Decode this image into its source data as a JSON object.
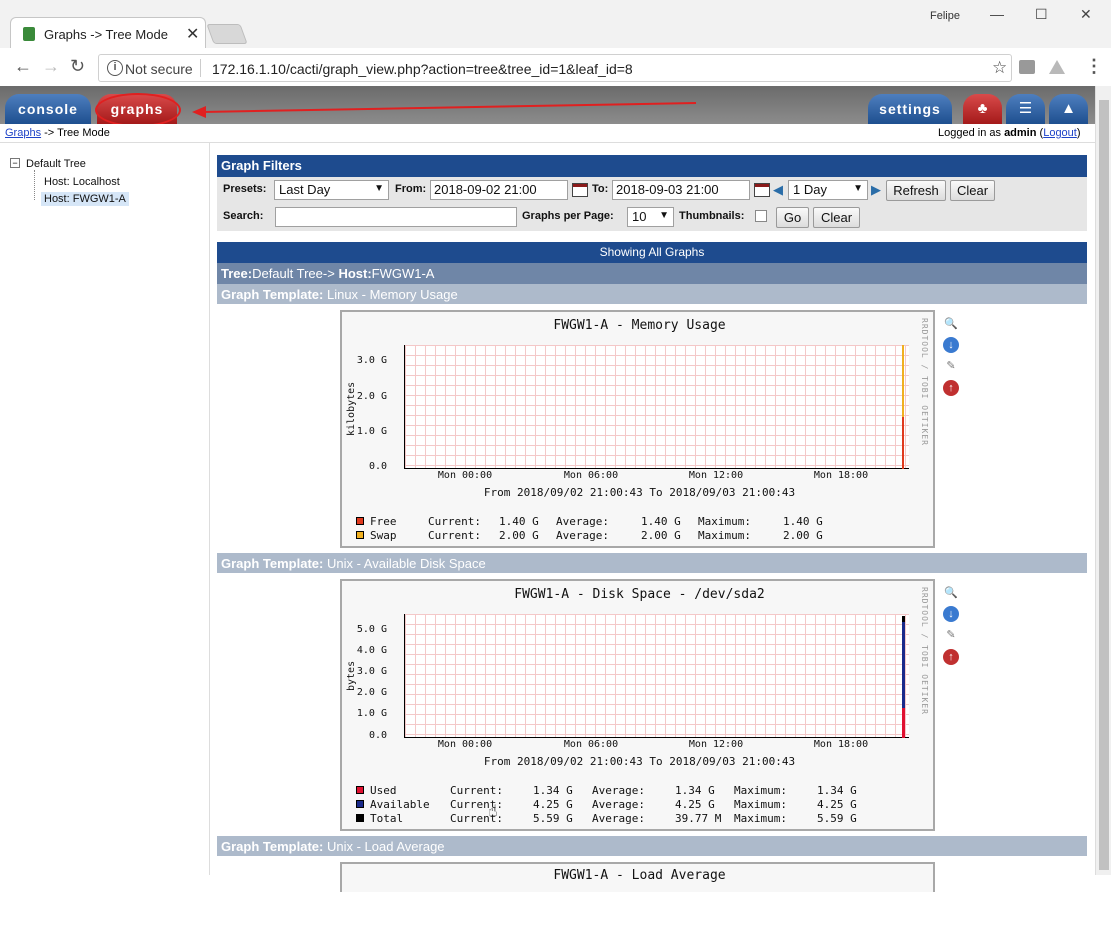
{
  "browser": {
    "tab_title": "Graphs -> Tree Mode",
    "close_glyph": "✕",
    "profile": "Felipe",
    "not_secure": "Not secure",
    "url": "172.16.1.10/cacti/graph_view.php?action=tree&tree_id=1&leaf_id=8"
  },
  "header": {
    "tabs": [
      "console",
      "graphs"
    ],
    "settings": "settings",
    "breadcrumb_link": "Graphs",
    "breadcrumb_rest": " -> Tree Mode",
    "logged_in_prefix": "Logged in as ",
    "user": "admin",
    "logout": "Logout"
  },
  "sidebar": {
    "root": "Default Tree",
    "items": [
      "Host: Localhost",
      "Host: FWGW1-A"
    ]
  },
  "filters": {
    "title": "Graph Filters",
    "presets_label": "Presets:",
    "presets_value": "Last Day",
    "from_label": "From:",
    "from_value": "2018-09-02 21:00",
    "to_label": "To:",
    "to_value": "2018-09-03 21:00",
    "span_value": "1 Day",
    "refresh": "Refresh",
    "clear": "Clear",
    "search_label": "Search:",
    "search_value": "",
    "per_page_label": "Graphs per Page:",
    "per_page_value": "10",
    "thumbnails_label": "Thumbnails:",
    "go": "Go",
    "clear2": "Clear"
  },
  "listing": {
    "showing": "Showing All Graphs",
    "tree_label": "Tree:",
    "tree_value": "Default Tree-> ",
    "host_label": "Host:",
    "host_value": "FWGW1-A",
    "template_label": "Graph Template:",
    "templates": [
      "Linux - Memory Usage",
      "Unix - Available Disk Space",
      "Unix - Load Average"
    ]
  },
  "graphs": [
    {
      "title": "FWGW1-A - Memory Usage",
      "ylabel": "kilobytes",
      "yticks": [
        "3.0 G",
        "2.0 G",
        "1.0 G",
        "0.0"
      ],
      "xticks": [
        "Mon 00:00",
        "Mon 06:00",
        "Mon 12:00",
        "Mon 18:00"
      ],
      "range": "From 2018/09/02 21:00:43 To 2018/09/03 21:00:43",
      "side": "RRDTOOL / TOBI OETIKER",
      "legend": [
        {
          "name": "Free",
          "color": "#e03a1e",
          "current": "1.40 G",
          "average": "1.40 G",
          "maximum": "1.40 G"
        },
        {
          "name": "Swap",
          "color": "#f0b020",
          "current": "2.00 G",
          "average": "2.00 G",
          "maximum": "2.00 G"
        }
      ]
    },
    {
      "title": "FWGW1-A - Disk Space - /dev/sda2",
      "ylabel": "bytes",
      "yticks": [
        "5.0 G",
        "4.0 G",
        "3.0 G",
        "2.0 G",
        "1.0 G",
        "0.0"
      ],
      "xticks": [
        "Mon 00:00",
        "Mon 06:00",
        "Mon 12:00",
        "Mon 18:00"
      ],
      "range": "From 2018/09/02 21:00:43 To 2018/09/03 21:00:43",
      "side": "RRDTOOL / TOBI OETIKER",
      "legend": [
        {
          "name": "Used",
          "color": "#e01030",
          "current": "1.34 G",
          "average": "1.34 G",
          "maximum": "1.34 G"
        },
        {
          "name": "Available",
          "color": "#1a2a8a",
          "current": "4.25 G",
          "average": "4.25 G",
          "maximum": "4.25 G"
        },
        {
          "name": "Total",
          "color": "#000000",
          "current": "5.59 G",
          "average": "39.77 M",
          "maximum": "5.59 G"
        }
      ]
    },
    {
      "title": "FWGW1-A - Load Average"
    }
  ],
  "legend_labels": {
    "current": "Current:",
    "average": "Average:",
    "maximum": "Maximum:"
  }
}
